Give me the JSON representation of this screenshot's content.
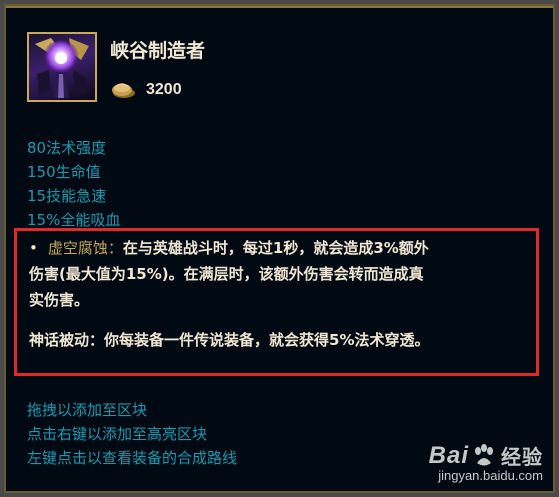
{
  "item": {
    "name": "峡谷制造者",
    "icon": "staff-orb-icon",
    "gold_icon": "gold-coin-icon",
    "cost": "3200"
  },
  "stats": [
    "80法术强度",
    "150生命值",
    "15技能急速",
    "15%全能吸血"
  ],
  "passive": {
    "bullet": "•",
    "name": "虚空腐蚀",
    "separator": "：",
    "line1_text": "在与英雄战斗时，每过1秒，就会造成3%额外",
    "line2_text": "伤害(最大值为15%)。在满层时，该额外伤害会转而造成真",
    "line3_text": "实伤害。"
  },
  "mythic": {
    "text": "神话被动：你每装备一件传说装备，就会获得5%法术穿透。"
  },
  "actions": [
    "拖拽以添加至区块",
    "点击右键以添加至高亮区块",
    "左键点击以查看装备的合成路线"
  ],
  "watermark": {
    "brand_left": "Bai",
    "brand_right": "经验",
    "url": "jingyan.baidu.com"
  },
  "colors": {
    "background": "#010a13",
    "stat_text": "#1a9ab0",
    "title_text": "#f0e6d2",
    "passive_name": "#c8a85a",
    "highlight_border": "#e02a2a",
    "frame": "#6b5a34"
  }
}
